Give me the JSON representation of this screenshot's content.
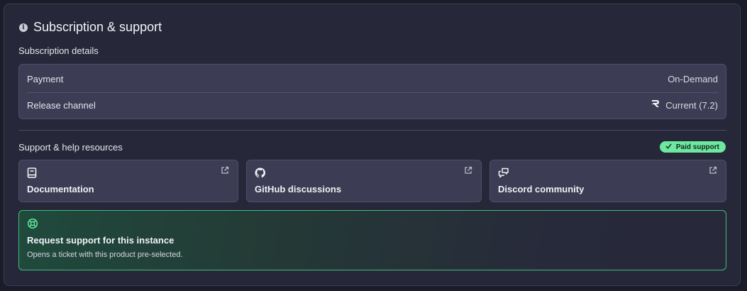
{
  "header": {
    "title": "Subscription & support",
    "info_icon": "info-icon"
  },
  "subscription": {
    "section_label": "Subscription details",
    "rows": [
      {
        "key": "Payment",
        "value": "On-Demand"
      },
      {
        "key": "Release channel",
        "value": "Current (7.2)",
        "icon": "r-logo-icon"
      }
    ]
  },
  "support": {
    "section_label": "Support & help resources",
    "badge": {
      "label": "Paid support",
      "color": "#6ee7a0"
    },
    "cards": [
      {
        "label": "Documentation",
        "icon": "book-icon"
      },
      {
        "label": "GitHub discussions",
        "icon": "github-icon"
      },
      {
        "label": "Discord community",
        "icon": "chat-icon"
      }
    ],
    "request": {
      "title": "Request support for this instance",
      "description": "Opens a ticket with this product pre-selected.",
      "icon": "lifebuoy-icon",
      "accent": "#3fbd7a"
    }
  }
}
